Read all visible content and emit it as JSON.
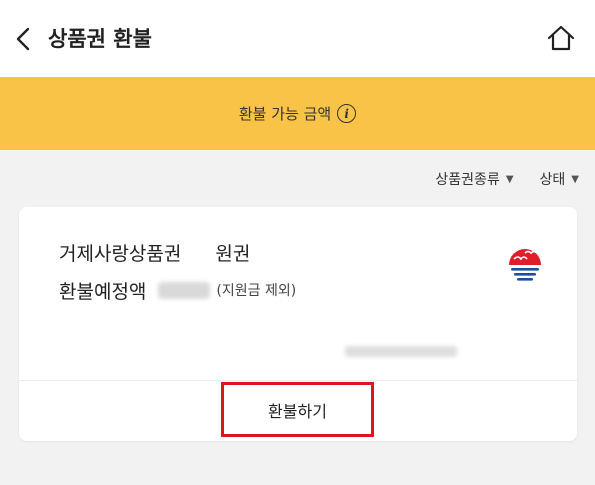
{
  "header": {
    "title": "상품권 환불",
    "back_icon": "chevron-left-icon",
    "home_icon": "home-icon"
  },
  "banner": {
    "label": "환불 가능 금액",
    "info_glyph": "i",
    "background": "#f8c347"
  },
  "filters": [
    {
      "label": "상품권종류"
    },
    {
      "label": "상태"
    }
  ],
  "card": {
    "voucher_name": "거제사랑상품권",
    "voucher_unit": "원권",
    "refund_amount_label": "환불예정액",
    "exclude_note": "(지원금 제외)",
    "logo_icon": "geoje-city-logo-icon",
    "refund_button_label": "환불하기",
    "highlight_color": "#e0141e"
  }
}
